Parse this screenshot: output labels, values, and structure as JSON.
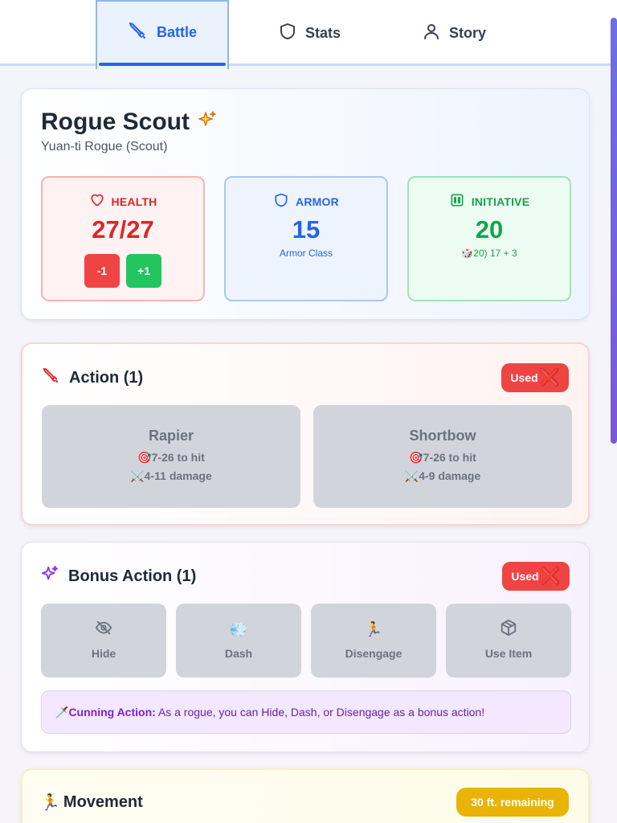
{
  "tabs": [
    {
      "label": "Battle",
      "icon": "sword-icon",
      "active": true
    },
    {
      "label": "Stats",
      "icon": "shield-icon",
      "active": false
    },
    {
      "label": "Story",
      "icon": "user-icon",
      "active": false
    }
  ],
  "character": {
    "name": "Rogue Scout",
    "name_icon": "sparkles-icon",
    "subtitle": "Yuan-ti Rogue (Scout)"
  },
  "stats": {
    "health": {
      "label": "HEALTH",
      "value": "27/27",
      "minus_label": "-1",
      "plus_label": "+1"
    },
    "armor": {
      "label": "ARMOR",
      "value": "15",
      "note": "Armor Class"
    },
    "initiative": {
      "label": "INITIATIVE",
      "value": "20",
      "note": "🎲20) 17 + 3"
    }
  },
  "action": {
    "title": "Action (1)",
    "badge": "Used",
    "badge_mark": "❌",
    "weapons": [
      {
        "name": "Rapier",
        "hit": "🎯7-26 to hit",
        "damage": "⚔️4-11 damage"
      },
      {
        "name": "Shortbow",
        "hit": "🎯7-26 to hit",
        "damage": "⚔️4-9 damage"
      }
    ]
  },
  "bonus_action": {
    "title": "Bonus Action (1)",
    "badge": "Used",
    "badge_mark": "❌",
    "buttons": [
      {
        "label": "Hide",
        "icon": "eye-off-icon"
      },
      {
        "label": "Dash",
        "icon": "💨"
      },
      {
        "label": "Disengage",
        "icon": "🏃"
      },
      {
        "label": "Use Item",
        "icon": "box-icon"
      }
    ],
    "cunning": {
      "icon": "🗡️",
      "title": "Cunning Action:",
      "text": " As a rogue, you can Hide, Dash, or Disengage as a bonus action!"
    }
  },
  "movement": {
    "icon": "🏃",
    "title": "Movement",
    "badge": "30 ft. remaining"
  },
  "colors": {
    "accent": "#2563eb",
    "health": "#dc2626",
    "armor": "#2563eb",
    "initiative": "#16a34a",
    "used_badge": "#ef4444",
    "movement_badge": "#eab308"
  }
}
